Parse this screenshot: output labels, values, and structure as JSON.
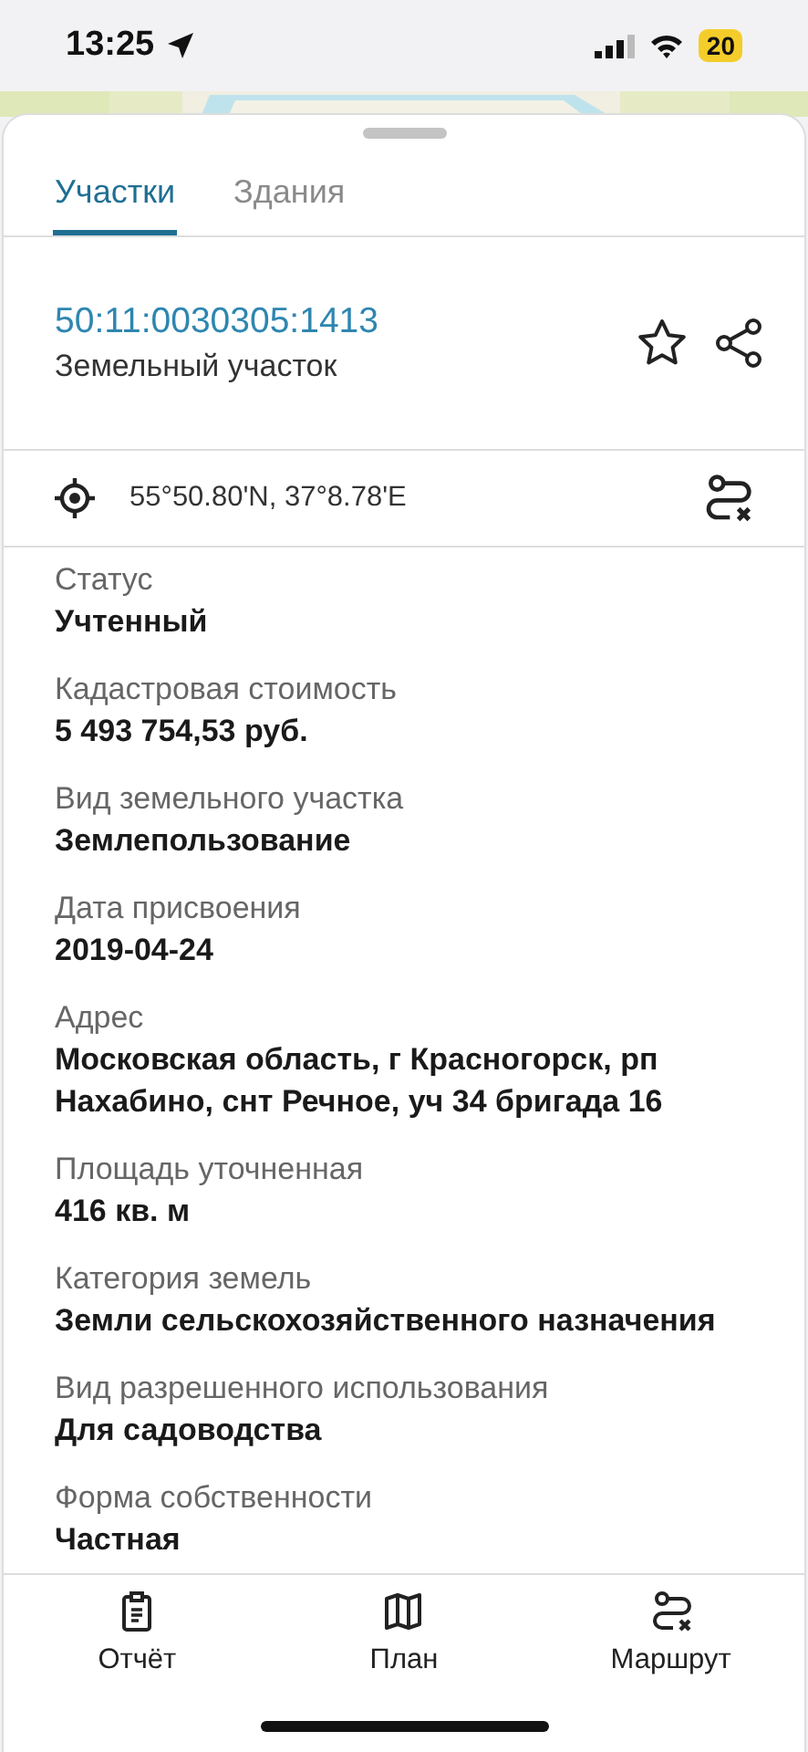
{
  "status_bar": {
    "time": "13:25",
    "battery": "20"
  },
  "tabs": [
    {
      "label": "Участки",
      "selected": true
    },
    {
      "label": "Здания",
      "selected": false
    }
  ],
  "parcel": {
    "number": "50:11:0030305:1413",
    "type": "Земельный участок"
  },
  "coordinates": "55°50.80'N, 37°8.78'E",
  "fields": [
    {
      "label": "Статус",
      "value": "Учтенный"
    },
    {
      "label": "Кадастровая стоимость",
      "value": "5 493 754,53 руб."
    },
    {
      "label": "Вид земельного участка",
      "value": "Землепользование"
    },
    {
      "label": "Дата присвоения",
      "value": "2019-04-24"
    },
    {
      "label": "Адрес",
      "value": "Московская область, г Красногорск, рп Нахабино, снт Речное, уч 34 бригада 16"
    },
    {
      "label": "Площадь уточненная",
      "value": "416 кв. м"
    },
    {
      "label": "Категория земель",
      "value": "Земли сельскохозяйственного назначения"
    },
    {
      "label": "Вид разрешенного использования",
      "value": "Для садоводства"
    },
    {
      "label": "Форма собственности",
      "value": "Частная"
    }
  ],
  "bottom_nav": [
    {
      "kind": "report",
      "label": "Отчёт"
    },
    {
      "kind": "map",
      "label": "План"
    },
    {
      "kind": "route",
      "label": "Маршрут"
    }
  ]
}
